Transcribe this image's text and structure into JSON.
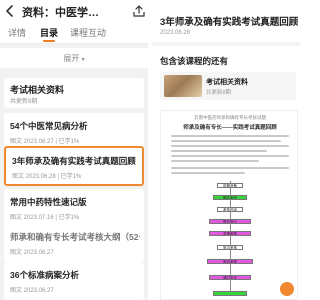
{
  "left": {
    "header": {
      "title": "资料：中医学…"
    },
    "tabs": [
      {
        "label": "详情",
        "active": false
      },
      {
        "label": "目录",
        "active": true
      },
      {
        "label": "课程互动",
        "active": false
      }
    ],
    "expand_label": "展开",
    "section": {
      "title": "考试相关资料",
      "subtitle": "共更新8期"
    },
    "items": [
      {
        "title": "54个中医常见病分析",
        "meta": "图文 2023.06.27 | 已学1%"
      },
      {
        "title": "3年师承及确有实践考试真题回顾",
        "meta": "图文 2023.06.28 | 已学1%"
      },
      {
        "title": "常用中药特性速记版",
        "meta": "图文 2023.07.16 | 已学1%"
      },
      {
        "title": "师承和确有专长考试考核大纲（52号）",
        "meta": "图文 2023.06.27"
      },
      {
        "title": "36个标准病案分析",
        "meta": "图文 2023.06.27"
      }
    ]
  },
  "right": {
    "title": "3年师承及确有实践考试真题回顾",
    "date": "2023.06.28",
    "included_heading": "包含该课程的还有",
    "included": {
      "title": "考试相关资料",
      "subtitle": "共更新8期"
    },
    "doc": {
      "head": "云南中医药师承和确有专长考核试题",
      "title": "师承及确有专长——实践考试真题回顾",
      "flow": [
        "前期准备",
        "确定考官",
        "考核时间",
        "报名登记",
        "资格审核",
        "笔试考核",
        "面试考核",
        "通过发证"
      ]
    }
  },
  "colors": {
    "accent": "#f0892f",
    "highlight_green": "#39d33d",
    "highlight_magenta": "#e257e0"
  }
}
